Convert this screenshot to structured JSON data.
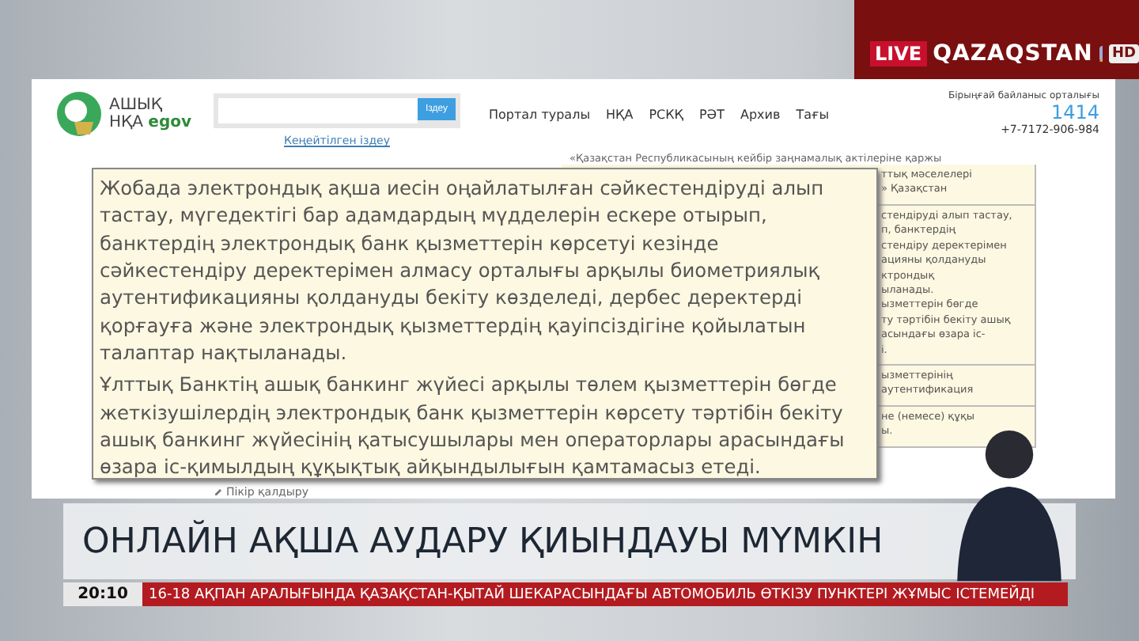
{
  "channel": {
    "live": "LIVE",
    "name": "QAZAQSTAN",
    "hd": "HD"
  },
  "site": {
    "logo": {
      "line1": "АШЫҚ",
      "line2": "НҚА",
      "egov": "egov"
    },
    "search": {
      "button": "Іздеу",
      "advanced": "Кеңейтілген іздеу"
    },
    "nav": [
      "Портал туралы",
      "НҚА",
      "РСКҚ",
      "РӘТ",
      "Архив",
      "Тағы"
    ],
    "contact": {
      "label": "Бірыңғай байланыс орталығы",
      "short": "1414",
      "phone": "+7-7172-906-984"
    },
    "table_heading": "«Қазақстан Республикасының кейбір заңнамалық актілеріне қаржы",
    "cells": [
      {
        "lines": [
          "ттық мәселелері",
          "» Қазақстан"
        ]
      },
      {
        "lines": [
          "стендіруді алып тастау,",
          "п, банктердің",
          "стендіру деректерімен",
          "ацияны қолдануды",
          "ктрондық",
          "ыланады.",
          "ызметтерін бөгде",
          "ту тәртібін бекіту ашық",
          "асындағы өзара іс-",
          "і."
        ]
      },
      {
        "lines": [
          "ызметтерінің",
          "аутентификация"
        ]
      },
      {
        "lines": [
          "не (немесе) құқы",
          "ы."
        ]
      }
    ],
    "tooltip": [
      "Жобада электрондық ақша иесін оңайлатылған сәйкестендіруді алып тастау, мүгедектігі бар адамдардың мүдделерін ескере отырып, банктердің электрондық банк қызметтерін көрсетуі кезінде сәйкестендіру деректерімен алмасу орталығы арқылы биометриялық аутентификацияны қолдануды бекіту көзделеді, дербес деректерді қорғауға және электрондық қызметтердің қауіпсіздігіне қойылатын талаптар нақтыланады.",
      "Ұлттық Банктің ашық банкинг жүйесі арқылы төлем қызметтерін бөгде жеткізушілердің электрондық банк қызметтерін көрсету тәртібін бекіту ашық банкинг жүйесінің қатысушылары мен операторлары арасындағы өзара іс-қимылдың құқықтық айқындылығын қамтамасыз етеді."
    ],
    "comment_link": "Пікір қалдыру"
  },
  "headline": "ОНЛАЙН АҚША АУДАРУ ҚИЫНДАУЫ МҮМКІН",
  "ticker": {
    "time": "20:10",
    "text": "16-18 АҚПАН АРАЛЫҒЫНДА ҚАЗАҚСТАН-ҚЫТАЙ ШЕКАРАСЫНДАҒЫ АВТОМОБИЛЬ ӨТКІЗУ ПУНКТЕРІ ЖҰМЫС ІСТЕМЕЙДІ"
  }
}
